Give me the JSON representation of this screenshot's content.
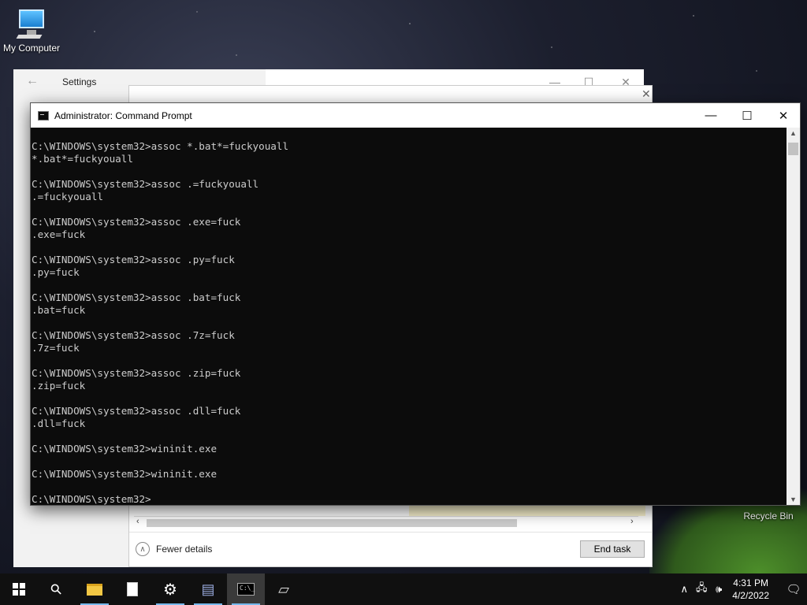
{
  "desktop": {
    "icons": [
      {
        "label": "My Computer"
      },
      {
        "label": "Recycle Bin"
      }
    ]
  },
  "settings_window": {
    "title": "Settings",
    "back_glyph": "←",
    "minimize_glyph": "—",
    "maximize_glyph": "☐",
    "close_glyph": "✕"
  },
  "task_manager": {
    "fewer_details_label": "Fewer details",
    "end_task_label": "End task",
    "close_glyph": "✕"
  },
  "cmd_window": {
    "title": "Administrator: Command Prompt",
    "minimize_glyph": "—",
    "maximize_glyph": "☐",
    "close_glyph": "✕",
    "lines": [
      "C:\\WINDOWS\\system32>assoc *.bat*=fuckyouall",
      "*.bat*=fuckyouall",
      "",
      "C:\\WINDOWS\\system32>assoc .=fuckyouall",
      ".=fuckyouall",
      "",
      "C:\\WINDOWS\\system32>assoc .exe=fuck",
      ".exe=fuck",
      "",
      "C:\\WINDOWS\\system32>assoc .py=fuck",
      ".py=fuck",
      "",
      "C:\\WINDOWS\\system32>assoc .bat=fuck",
      ".bat=fuck",
      "",
      "C:\\WINDOWS\\system32>assoc .7z=fuck",
      ".7z=fuck",
      "",
      "C:\\WINDOWS\\system32>assoc .zip=fuck",
      ".zip=fuck",
      "",
      "C:\\WINDOWS\\system32>assoc .dll=fuck",
      ".dll=fuck",
      "",
      "C:\\WINDOWS\\system32>wininit.exe",
      "",
      "C:\\WINDOWS\\system32>wininit.exe",
      "",
      "C:\\WINDOWS\\system32>"
    ]
  },
  "taskbar": {
    "items": [
      {
        "name": "start",
        "icon": "windows-logo-icon"
      },
      {
        "name": "search",
        "icon": "search-icon",
        "glyph": "⚲"
      },
      {
        "name": "file-explorer",
        "icon": "folder-icon"
      },
      {
        "name": "notepad",
        "icon": "file-icon"
      },
      {
        "name": "settings",
        "icon": "gear-icon",
        "glyph": "⚙"
      },
      {
        "name": "task-manager",
        "icon": "task-manager-icon",
        "glyph": "▤"
      },
      {
        "name": "command-prompt",
        "icon": "cmd-icon",
        "glyph": "C:\\_"
      },
      {
        "name": "drive",
        "icon": "drive-icon",
        "glyph": "▱"
      }
    ],
    "tray": {
      "chevron_glyph": "∧",
      "network_glyph": "🖧",
      "volume_glyph": "🕪",
      "time": "4:31 PM",
      "date": "4/2/2022",
      "notification_glyph": "🗨"
    }
  }
}
